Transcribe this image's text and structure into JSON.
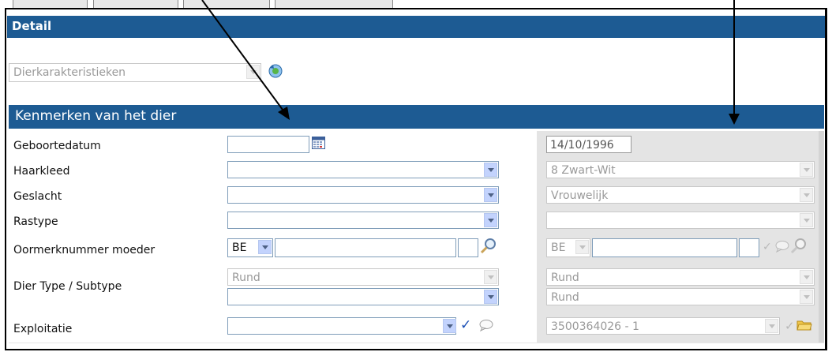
{
  "header": {
    "title": "Detail"
  },
  "view_select": {
    "value": "Dierkarakteristieken"
  },
  "section": {
    "title": "Kenmerken van het dier"
  },
  "rows": {
    "geboortedatum": {
      "label": "Geboortedatum",
      "ref_value": "14/10/1996"
    },
    "haarkleed": {
      "label": "Haarkleed",
      "ref_value": "8 Zwart-Wit"
    },
    "geslacht": {
      "label": "Geslacht",
      "ref_value": "Vrouwelijk"
    },
    "rastype": {
      "label": "Rastype",
      "ref_value": ""
    },
    "oormerk": {
      "label": "Oormerknummer moeder",
      "country": "BE",
      "ref_country": "BE"
    },
    "diertype": {
      "label": "Dier Type / Subtype",
      "type_value": "Rund",
      "ref_type": "Rund",
      "ref_subtype": "Rund"
    },
    "exploitatie": {
      "label": "Exploitatie",
      "ref_value": "3500364026 - 1"
    }
  },
  "icons": {
    "accent": "#1d5b93",
    "check_color": "#1a4fb5"
  }
}
